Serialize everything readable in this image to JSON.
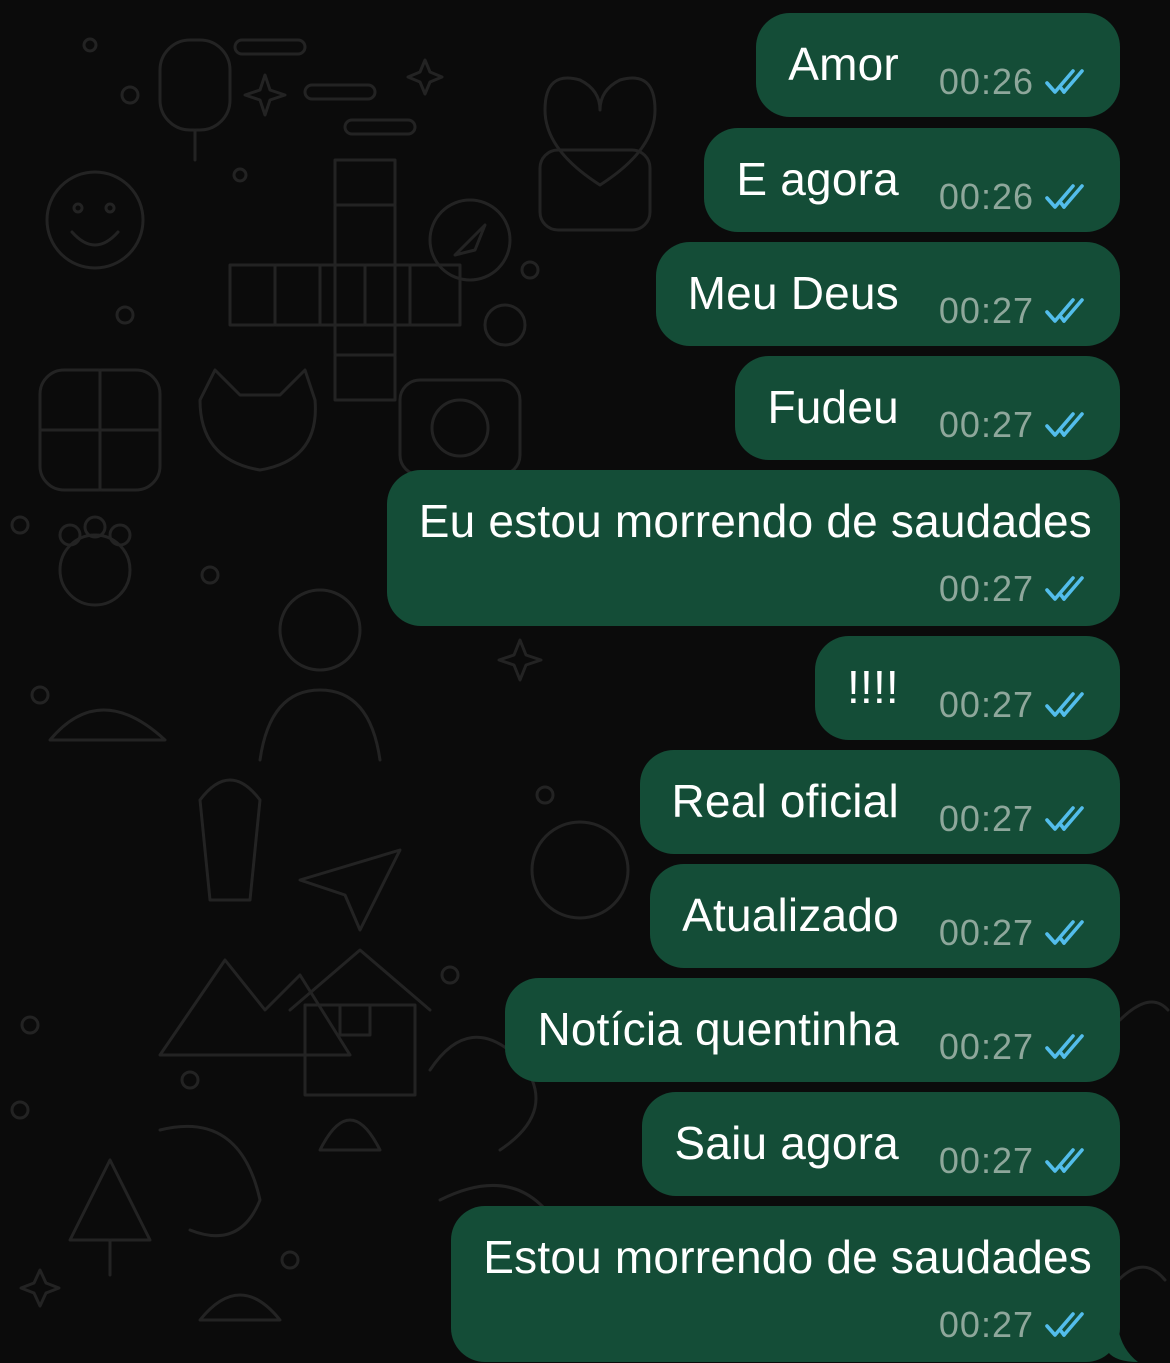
{
  "chat": {
    "messages": [
      {
        "text": "Amor",
        "time": "00:26",
        "status": "read"
      },
      {
        "text": "E agora",
        "time": "00:26",
        "status": "read"
      },
      {
        "text": "Meu Deus",
        "time": "00:27",
        "status": "read"
      },
      {
        "text": "Fudeu",
        "time": "00:27",
        "status": "read"
      },
      {
        "text": "Eu estou morrendo de saudades",
        "time": "00:27",
        "status": "read"
      },
      {
        "text": "!!!!",
        "time": "00:27",
        "status": "read"
      },
      {
        "text": "Real oficial",
        "time": "00:27",
        "status": "read"
      },
      {
        "text": "Atualizado",
        "time": "00:27",
        "status": "read"
      },
      {
        "text": "Notícia quentinha",
        "time": "00:27",
        "status": "read"
      },
      {
        "text": "Saiu agora",
        "time": "00:27",
        "status": "read"
      },
      {
        "text": "Estou morrendo de saudades",
        "time": "00:27",
        "status": "read"
      }
    ]
  },
  "colors": {
    "background": "#0b0b0b",
    "outgoing_bubble": "#144d37",
    "message_text": "#ffffff",
    "timestamp": "#8ea79b",
    "read_ticks": "#53bdeb",
    "wallpaper_doodles": "#232323"
  },
  "icons": {
    "read_status": "double-check-icon",
    "wallpaper": "doodle-pattern"
  }
}
